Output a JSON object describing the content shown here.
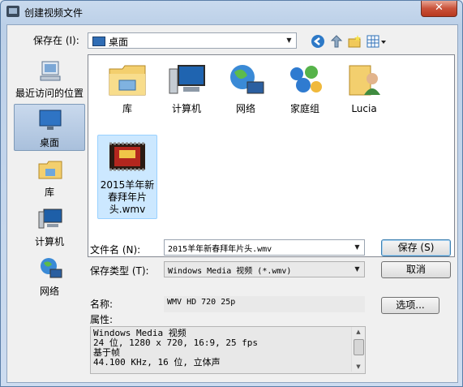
{
  "title": "创建视频文件",
  "close_label": "✕",
  "save_in": {
    "label": "保存在 (I):",
    "value": "桌面"
  },
  "places": [
    {
      "label": "最近访问的位置",
      "icon": "recent-places-icon"
    },
    {
      "label": "桌面",
      "icon": "desktop-icon"
    },
    {
      "label": "库",
      "icon": "library-icon"
    },
    {
      "label": "计算机",
      "icon": "computer-icon"
    },
    {
      "label": "网络",
      "icon": "network-icon"
    }
  ],
  "items": [
    {
      "label": "库",
      "icon": "library-folder-icon"
    },
    {
      "label": "计算机",
      "icon": "computer-icon"
    },
    {
      "label": "网络",
      "icon": "network-icon"
    },
    {
      "label": "家庭组",
      "icon": "homegroup-icon"
    },
    {
      "label": "Lucia",
      "icon": "user-folder-icon"
    },
    {
      "label": "2015羊年新春拜年片头.wmv",
      "icon": "video-file-icon"
    }
  ],
  "filename": {
    "label": "文件名 (N):",
    "value": "2015羊年新春拜年片头.wmv"
  },
  "filetype": {
    "label": "保存类型 (T):",
    "value": "Windows Media 视频 (*.wmv)"
  },
  "buttons": {
    "save": "保存 (S)",
    "cancel": "取消",
    "options": "选项..."
  },
  "name": {
    "label": "名称:",
    "value": "WMV HD 720 25p"
  },
  "properties": {
    "label": "属性:",
    "lines": [
      "Windows Media 视频",
      "24 位, 1280 x 720, 16:9, 25 fps",
      "基于帧",
      "44.100 KHz, 16 位, 立体声"
    ]
  }
}
